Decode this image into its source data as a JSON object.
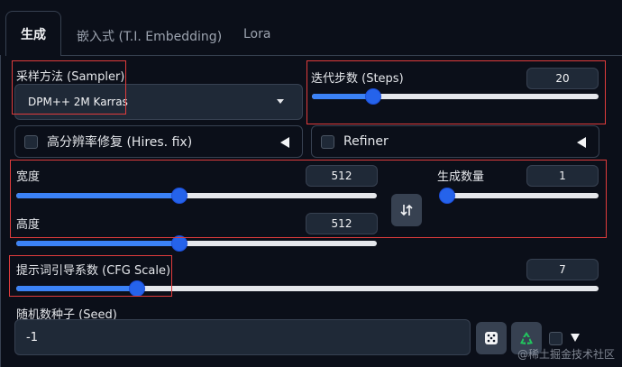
{
  "tabs": [
    {
      "label": "生成"
    },
    {
      "label": "嵌入式 (T.I. Embedding)"
    },
    {
      "label": "Lora"
    }
  ],
  "sampler": {
    "label": "采样方法 (Sampler)",
    "value": "DPM++ 2M Karras"
  },
  "steps": {
    "label": "迭代步数 (Steps)",
    "value": "20",
    "level": 0.2
  },
  "hires": {
    "label": "高分辨率修复 (Hires. fix)"
  },
  "refiner": {
    "label": "Refiner"
  },
  "width": {
    "label": "宽度",
    "value": "512",
    "level": 0.45
  },
  "height": {
    "label": "高度",
    "value": "512",
    "level": 0.45
  },
  "batch": {
    "label": "生成数量",
    "value": "1",
    "level": 0.0
  },
  "cfg": {
    "label": "提示词引导系数 (CFG Scale)",
    "value": "7",
    "level": 0.2
  },
  "seed": {
    "label": "随机数种子 (Seed)",
    "value": "-1"
  },
  "icons": {
    "swap": "swap-icon",
    "dice": "dice-icon",
    "recycle": "recycle-icon",
    "caret": "triangle-down-icon"
  },
  "colors": {
    "accent": "#3b82f6",
    "highlight": "#e03c3c",
    "background": "#0b0f19"
  },
  "watermark": "@稀土掘金技术社区"
}
